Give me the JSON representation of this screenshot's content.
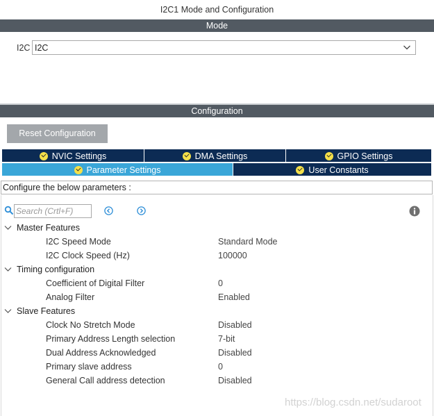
{
  "window": {
    "title": "I2C1 Mode and Configuration"
  },
  "mode": {
    "header": "Mode",
    "label": "I2C",
    "selected": "I2C"
  },
  "configuration": {
    "header": "Configuration",
    "reset_label": "Reset Configuration",
    "tabs_row1": [
      {
        "label": "NVIC Settings"
      },
      {
        "label": "DMA Settings"
      },
      {
        "label": "GPIO Settings"
      }
    ],
    "tabs_row2": [
      {
        "label": "Parameter Settings",
        "active": true
      },
      {
        "label": "User Constants"
      }
    ],
    "description": "Configure the below parameters :",
    "search": {
      "placeholder": "Search (Crtl+F)"
    },
    "groups": [
      {
        "label": "Master Features",
        "params": [
          {
            "label": "I2C Speed Mode",
            "value": "Standard Mode"
          },
          {
            "label": "I2C Clock Speed (Hz)",
            "value": "100000"
          }
        ]
      },
      {
        "label": "Timing configuration",
        "params": [
          {
            "label": "Coefficient of Digital Filter",
            "value": "0"
          },
          {
            "label": "Analog Filter",
            "value": "Enabled"
          }
        ]
      },
      {
        "label": "Slave Features",
        "params": [
          {
            "label": "Clock No Stretch Mode",
            "value": "Disabled"
          },
          {
            "label": "Primary Address Length selection",
            "value": "7-bit"
          },
          {
            "label": "Dual Address Acknowledged",
            "value": "Disabled"
          },
          {
            "label": "Primary slave address",
            "value": "0"
          },
          {
            "label": "General Call address detection",
            "value": "Disabled"
          }
        ]
      }
    ]
  },
  "watermark": "https://blog.csdn.net/sudaroot",
  "icons": {
    "search": "search-icon",
    "prev": "chevron-left-circle-icon",
    "next": "chevron-right-circle-icon",
    "info": "info-icon",
    "check": "check-circle-icon",
    "expander": "chevron-down-icon",
    "dropdown": "chevron-down-icon"
  },
  "colors": {
    "band": "#525a62",
    "tab": "#0c2b54",
    "tab_active": "#3aa6d8",
    "check": "#f4e04a",
    "reset_button": "#a3a7ab",
    "nav_icon": "#2f8fd8"
  }
}
